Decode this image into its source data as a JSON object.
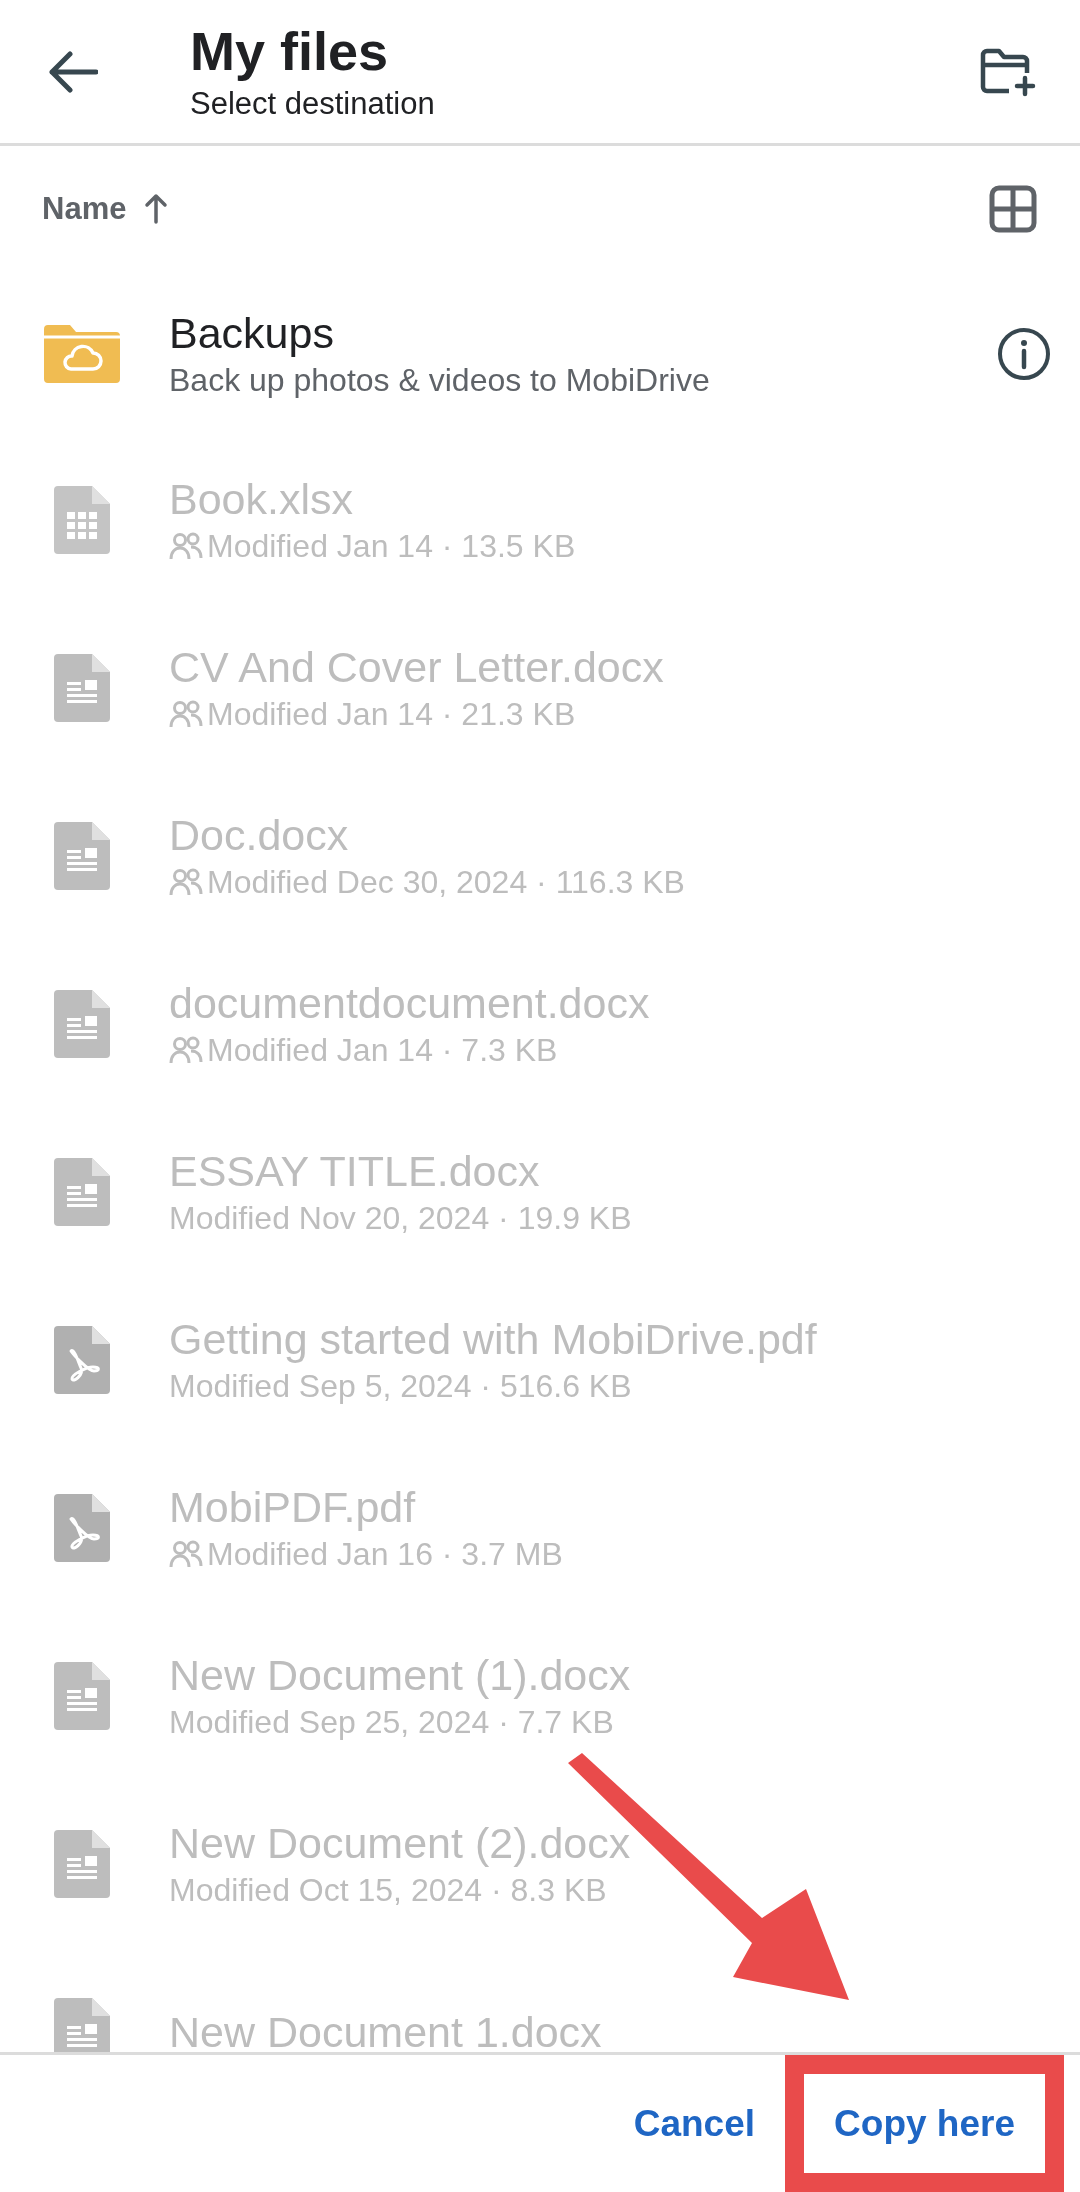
{
  "header": {
    "title": "My files",
    "subtitle": "Select destination"
  },
  "sort": {
    "label": "Name",
    "ascending": true
  },
  "items": [
    {
      "kind": "folder",
      "name": "Backups",
      "detail": "Back up photos & videos to MobiDrive",
      "disabled": false,
      "shared": false
    },
    {
      "kind": "spreadsheet",
      "name": "Book.xlsx",
      "detail": "Modified Jan 14 · 13.5 KB",
      "disabled": true,
      "shared": true
    },
    {
      "kind": "document",
      "name": "CV And Cover Letter.docx",
      "detail": "Modified Jan 14 · 21.3 KB",
      "disabled": true,
      "shared": true
    },
    {
      "kind": "document",
      "name": "Doc.docx",
      "detail": "Modified Dec 30, 2024 · 116.3 KB",
      "disabled": true,
      "shared": true
    },
    {
      "kind": "document",
      "name": "documentdocument.docx",
      "detail": "Modified Jan 14 · 7.3 KB",
      "disabled": true,
      "shared": true
    },
    {
      "kind": "document",
      "name": "ESSAY TITLE.docx",
      "detail": "Modified Nov 20, 2024 · 19.9 KB",
      "disabled": true,
      "shared": false
    },
    {
      "kind": "pdf",
      "name": "Getting started with MobiDrive.pdf",
      "detail": "Modified Sep 5, 2024 · 516.6 KB",
      "disabled": true,
      "shared": false
    },
    {
      "kind": "pdf",
      "name": "MobiPDF.pdf",
      "detail": "Modified Jan 16 · 3.7 MB",
      "disabled": true,
      "shared": true
    },
    {
      "kind": "document",
      "name": "New Document (1).docx",
      "detail": "Modified Sep 25, 2024 · 7.7 KB",
      "disabled": true,
      "shared": false
    },
    {
      "kind": "document",
      "name": "New Document (2).docx",
      "detail": "Modified Oct 15, 2024 · 8.3 KB",
      "disabled": true,
      "shared": false
    },
    {
      "kind": "document",
      "name": "New Document 1.docx",
      "disabled": true
    }
  ],
  "buttons": [
    {
      "label": "Cancel",
      "highlighted": false
    },
    {
      "label": "Copy here",
      "highlighted": true
    }
  ]
}
